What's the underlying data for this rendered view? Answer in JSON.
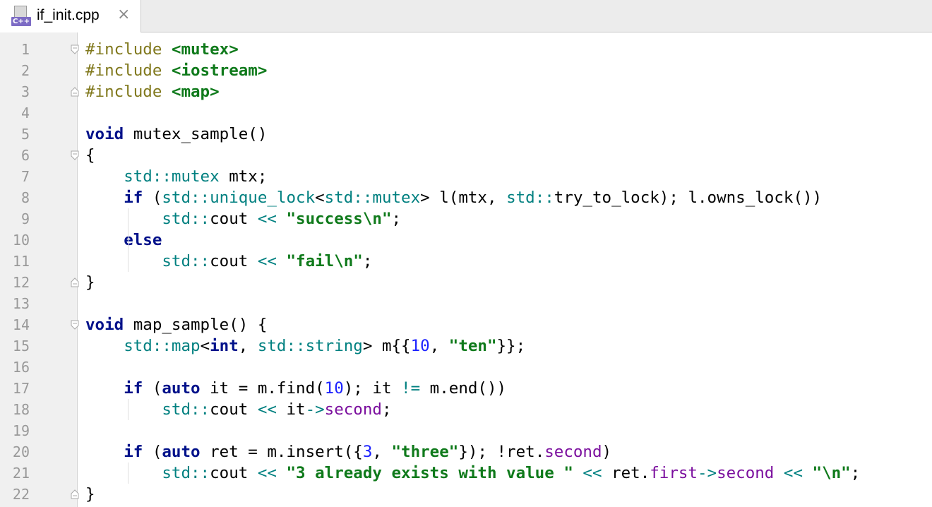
{
  "editor_tab": {
    "file_name": "if_init.cpp",
    "language_badge": "C++",
    "close_icon": "×"
  },
  "gutter": {
    "line_numbers": [
      "1",
      "2",
      "3",
      "4",
      "5",
      "6",
      "7",
      "8",
      "9",
      "10",
      "11",
      "12",
      "13",
      "14",
      "15",
      "16",
      "17",
      "18",
      "19",
      "20",
      "21",
      "22"
    ]
  },
  "code": {
    "lines": [
      [
        {
          "t": "#include ",
          "c": "pp"
        },
        {
          "t": "<mutex>",
          "c": "inc"
        }
      ],
      [
        {
          "t": "#include ",
          "c": "pp"
        },
        {
          "t": "<iostream>",
          "c": "inc"
        }
      ],
      [
        {
          "t": "#include ",
          "c": "pp"
        },
        {
          "t": "<map>",
          "c": "inc"
        }
      ],
      [],
      [
        {
          "t": "void",
          "c": "kw"
        },
        {
          "t": " mutex_sample()",
          "c": "fn"
        }
      ],
      [
        {
          "t": "{",
          "c": "fn"
        }
      ],
      [
        {
          "t": "    ",
          "c": "fn"
        },
        {
          "t": "std::",
          "c": "ns"
        },
        {
          "t": "mutex",
          "c": "ty"
        },
        {
          "t": " mtx;",
          "c": "fn"
        }
      ],
      [
        {
          "t": "    ",
          "c": "fn"
        },
        {
          "t": "if",
          "c": "kw"
        },
        {
          "t": " (",
          "c": "fn"
        },
        {
          "t": "std::",
          "c": "ns"
        },
        {
          "t": "unique_lock",
          "c": "ty"
        },
        {
          "t": "<",
          "c": "fn"
        },
        {
          "t": "std::",
          "c": "ns"
        },
        {
          "t": "mutex",
          "c": "ty"
        },
        {
          "t": "> l(mtx, ",
          "c": "fn"
        },
        {
          "t": "std::",
          "c": "ns"
        },
        {
          "t": "try_to_lock); l.owns_lock())",
          "c": "fn"
        }
      ],
      [
        {
          "t": "        ",
          "c": "fn"
        },
        {
          "t": "std::",
          "c": "ns"
        },
        {
          "t": "cout ",
          "c": "fn"
        },
        {
          "t": "<<",
          "c": "op"
        },
        {
          "t": " ",
          "c": "fn"
        },
        {
          "t": "\"success\\n\"",
          "c": "str"
        },
        {
          "t": ";",
          "c": "fn"
        }
      ],
      [
        {
          "t": "    ",
          "c": "fn"
        },
        {
          "t": "else",
          "c": "kw"
        }
      ],
      [
        {
          "t": "        ",
          "c": "fn"
        },
        {
          "t": "std::",
          "c": "ns"
        },
        {
          "t": "cout ",
          "c": "fn"
        },
        {
          "t": "<<",
          "c": "op"
        },
        {
          "t": " ",
          "c": "fn"
        },
        {
          "t": "\"fail\\n\"",
          "c": "str"
        },
        {
          "t": ";",
          "c": "fn"
        }
      ],
      [
        {
          "t": "}",
          "c": "fn"
        }
      ],
      [],
      [
        {
          "t": "void",
          "c": "kw"
        },
        {
          "t": " map_sample() {",
          "c": "fn"
        }
      ],
      [
        {
          "t": "    ",
          "c": "fn"
        },
        {
          "t": "std::",
          "c": "ns"
        },
        {
          "t": "map",
          "c": "ty"
        },
        {
          "t": "<",
          "c": "fn"
        },
        {
          "t": "int",
          "c": "kw"
        },
        {
          "t": ", ",
          "c": "fn"
        },
        {
          "t": "std::",
          "c": "ns"
        },
        {
          "t": "string",
          "c": "ty"
        },
        {
          "t": "> m{{",
          "c": "fn"
        },
        {
          "t": "10",
          "c": "num"
        },
        {
          "t": ", ",
          "c": "fn"
        },
        {
          "t": "\"ten\"",
          "c": "str"
        },
        {
          "t": "}};",
          "c": "fn"
        }
      ],
      [],
      [
        {
          "t": "    ",
          "c": "fn"
        },
        {
          "t": "if",
          "c": "kw"
        },
        {
          "t": " (",
          "c": "fn"
        },
        {
          "t": "auto",
          "c": "kw"
        },
        {
          "t": " it = m.find(",
          "c": "fn"
        },
        {
          "t": "10",
          "c": "num"
        },
        {
          "t": "); it ",
          "c": "fn"
        },
        {
          "t": "!=",
          "c": "op"
        },
        {
          "t": " m.end())",
          "c": "fn"
        }
      ],
      [
        {
          "t": "        ",
          "c": "fn"
        },
        {
          "t": "std::",
          "c": "ns"
        },
        {
          "t": "cout ",
          "c": "fn"
        },
        {
          "t": "<<",
          "c": "op"
        },
        {
          "t": " it",
          "c": "fn"
        },
        {
          "t": "->",
          "c": "op"
        },
        {
          "t": "second",
          "c": "mem"
        },
        {
          "t": ";",
          "c": "fn"
        }
      ],
      [],
      [
        {
          "t": "    ",
          "c": "fn"
        },
        {
          "t": "if",
          "c": "kw"
        },
        {
          "t": " (",
          "c": "fn"
        },
        {
          "t": "auto",
          "c": "kw"
        },
        {
          "t": " ret = m.insert({",
          "c": "fn"
        },
        {
          "t": "3",
          "c": "num"
        },
        {
          "t": ", ",
          "c": "fn"
        },
        {
          "t": "\"three\"",
          "c": "str"
        },
        {
          "t": "}); !ret.",
          "c": "fn"
        },
        {
          "t": "second",
          "c": "mem"
        },
        {
          "t": ")",
          "c": "fn"
        }
      ],
      [
        {
          "t": "        ",
          "c": "fn"
        },
        {
          "t": "std::",
          "c": "ns"
        },
        {
          "t": "cout ",
          "c": "fn"
        },
        {
          "t": "<<",
          "c": "op"
        },
        {
          "t": " ",
          "c": "fn"
        },
        {
          "t": "\"3 already exists with value \"",
          "c": "str"
        },
        {
          "t": " ",
          "c": "fn"
        },
        {
          "t": "<<",
          "c": "op"
        },
        {
          "t": " ret.",
          "c": "fn"
        },
        {
          "t": "first",
          "c": "mem"
        },
        {
          "t": "->",
          "c": "op"
        },
        {
          "t": "second",
          "c": "mem"
        },
        {
          "t": " ",
          "c": "fn"
        },
        {
          "t": "<<",
          "c": "op"
        },
        {
          "t": " ",
          "c": "fn"
        },
        {
          "t": "\"\\n\"",
          "c": "str"
        },
        {
          "t": ";",
          "c": "fn"
        }
      ],
      [
        {
          "t": "}",
          "c": "fn"
        }
      ]
    ]
  }
}
